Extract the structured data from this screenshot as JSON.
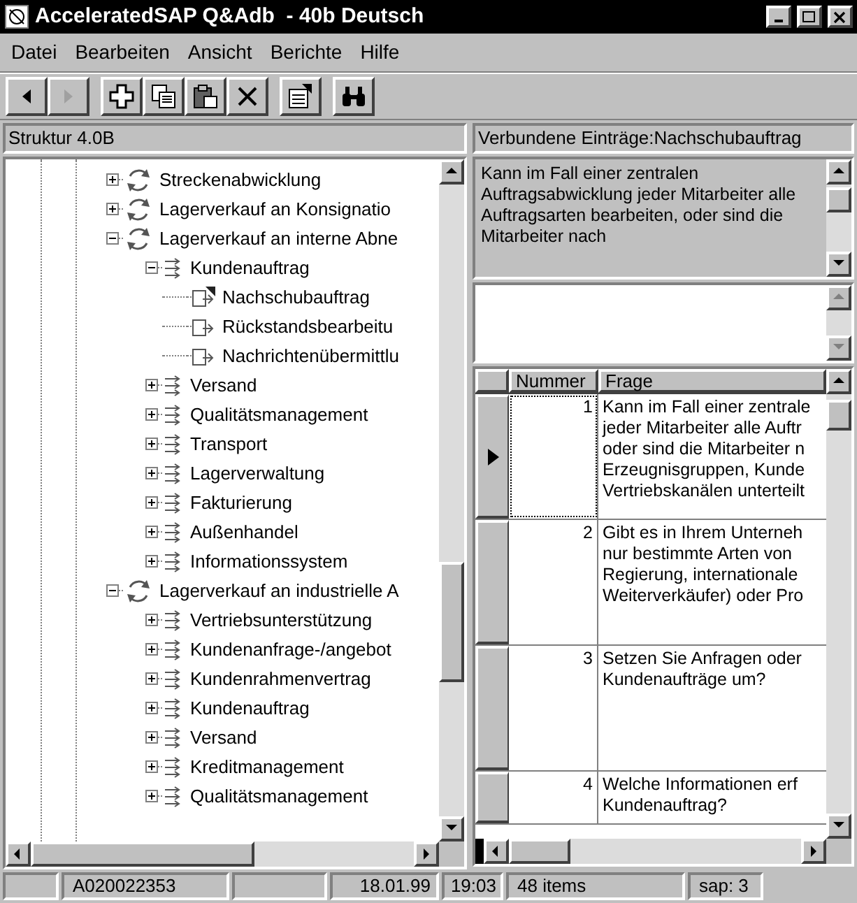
{
  "window": {
    "title": "AcceleratedSAP Q&Adb  - 40b Deutsch"
  },
  "menu": [
    "Datei",
    "Bearbeiten",
    "Ansicht",
    "Berichte",
    "Hilfe"
  ],
  "toolbar": [
    {
      "kind": "back",
      "disabled": false
    },
    {
      "kind": "forward",
      "disabled": true
    },
    {
      "kind": "add",
      "disabled": false
    },
    {
      "kind": "copy",
      "disabled": false
    },
    {
      "kind": "paste",
      "disabled": false
    },
    {
      "kind": "delete",
      "disabled": false
    },
    {
      "kind": "properties",
      "disabled": false
    },
    {
      "kind": "find",
      "disabled": false
    }
  ],
  "tree": {
    "header": "Struktur 4.0B",
    "items": [
      {
        "kind": "process",
        "label": "Streckenabwicklung",
        "expanded": false
      },
      {
        "kind": "process",
        "label": "Lagerverkauf an Konsignatio",
        "expanded": false
      },
      {
        "kind": "process",
        "label": "Lagerverkauf an interne Abne",
        "expanded": true,
        "children": [
          {
            "kind": "step",
            "label": "Kundenauftrag",
            "expanded": true,
            "children": [
              {
                "kind": "leaf",
                "label": "Nachschubauftrag",
                "marked": true
              },
              {
                "kind": "leaf",
                "label": "Rückstandsbearbeitu",
                "marked": false
              },
              {
                "kind": "leaf",
                "label": "Nachrichtenübermittlu",
                "marked": false
              }
            ]
          },
          {
            "kind": "step",
            "label": "Versand",
            "expanded": false
          },
          {
            "kind": "step",
            "label": "Qualitätsmanagement",
            "expanded": false
          },
          {
            "kind": "step",
            "label": "Transport",
            "expanded": false
          },
          {
            "kind": "step",
            "label": "Lagerverwaltung",
            "expanded": false
          },
          {
            "kind": "step",
            "label": "Fakturierung",
            "expanded": false
          },
          {
            "kind": "step",
            "label": "Außenhandel",
            "expanded": false
          },
          {
            "kind": "step",
            "label": "Informationssystem",
            "expanded": false
          }
        ]
      },
      {
        "kind": "process",
        "label": "Lagerverkauf an industrielle A",
        "expanded": true,
        "children": [
          {
            "kind": "step",
            "label": "Vertriebsunterstützung",
            "expanded": false
          },
          {
            "kind": "step",
            "label": "Kundenanfrage-/angebot",
            "expanded": false
          },
          {
            "kind": "step",
            "label": "Kundenrahmenvertrag",
            "expanded": false
          },
          {
            "kind": "step",
            "label": "Kundenauftrag",
            "expanded": false
          },
          {
            "kind": "step",
            "label": "Versand",
            "expanded": false
          },
          {
            "kind": "step",
            "label": "Kreditmanagement",
            "expanded": false
          },
          {
            "kind": "step",
            "label": "Qualitätsmanagement",
            "expanded": false
          }
        ]
      }
    ]
  },
  "details": {
    "header": "Verbundene Einträge:Nachschubauftrag",
    "question": "Kann im Fall einer zentralen Auftragsabwicklung jeder Mitarbeiter alle Auftragsarten bearbeiten, oder sind die Mitarbeiter nach",
    "table": {
      "columns": [
        "Nummer",
        "Frage"
      ],
      "rows": [
        {
          "nummer": "1",
          "frage": "Kann im Fall einer zentrale\njeder Mitarbeiter alle Auftr\noder sind die Mitarbeiter n\nErzeugnisgruppen, Kunde\nVertriebskanälen unterteilt",
          "selected": true
        },
        {
          "nummer": "2",
          "frage": "Gibt es in Ihrem Unterneh\nnur bestimmte Arten von\nRegierung, internationale\nWeiterverkäufer) oder Pro",
          "selected": false
        },
        {
          "nummer": "3",
          "frage": "Setzen Sie Anfragen oder\nKundenaufträge um?",
          "selected": false
        },
        {
          "nummer": "4",
          "frage": "Welche Informationen erf\nKundenauftrag?",
          "selected": false
        }
      ]
    }
  },
  "status_bar": {
    "id": "A020022353",
    "date": "18.01.99",
    "time": "19:03",
    "count": "48 items",
    "user": "sap: 3"
  }
}
